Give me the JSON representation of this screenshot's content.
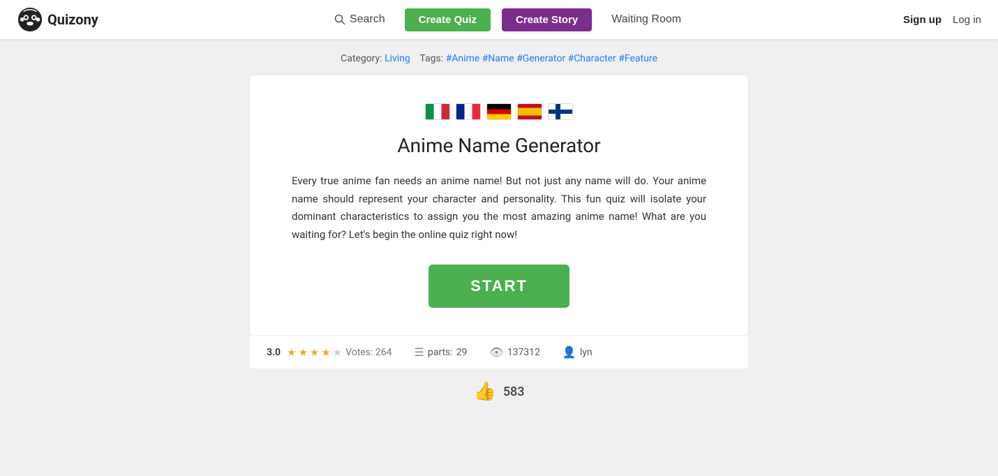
{
  "navbar": {
    "brand_name": "Quizony",
    "search_label": "Search",
    "create_quiz_label": "Create Quiz",
    "create_story_label": "Create Story",
    "waiting_room_label": "Waiting Room",
    "signup_label": "Sign up",
    "login_label": "Log in"
  },
  "category_bar": {
    "prefix": "Category:",
    "category": "Living",
    "tags_prefix": "Tags:",
    "tags": [
      "#Anime",
      "#Name",
      "#Generator",
      "#Character",
      "#Feature"
    ]
  },
  "quiz": {
    "title": "Anime Name Generator",
    "description": "Every true anime fan needs an anime name! But not just any name will do. Your anime name should represent your character and personality. This fun quiz will isolate your dominant characteristics to assign you the most amazing anime name! What are you waiting for? Let's begin the online quiz right now!",
    "start_label": "START",
    "flags": [
      {
        "name": "italy",
        "label": "Italian"
      },
      {
        "name": "france",
        "label": "French"
      },
      {
        "name": "germany",
        "label": "German"
      },
      {
        "name": "spain",
        "label": "Spanish"
      },
      {
        "name": "finland",
        "label": "Finnish"
      }
    ]
  },
  "stats": {
    "rating": "3.0",
    "votes_label": "Votes: 264",
    "parts_label": "parts:",
    "parts_count": "29",
    "views_count": "137312",
    "author": "lyn"
  },
  "likes": {
    "count": "583"
  }
}
